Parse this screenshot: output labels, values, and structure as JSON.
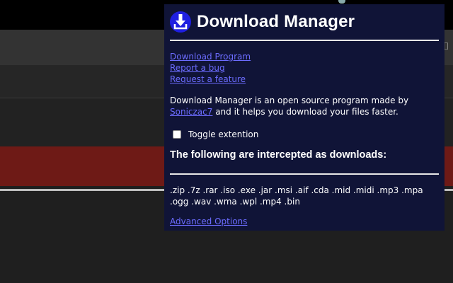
{
  "popup": {
    "title": "Download Manager",
    "links": [
      {
        "label": "Download Program"
      },
      {
        "label": "Report a bug"
      },
      {
        "label": "Request a feature"
      }
    ],
    "description_prefix": "Download Manager is an open source program made by ",
    "author": "Soniczac7",
    "description_suffix": " and it helps you download your files faster.",
    "toggle_label": "Toggle extention",
    "toggle_checked": false,
    "intercepted_heading": "The following are intercepted as downloads:",
    "extensions": ".zip .7z .rar .iso .exe .jar .msi .aif .cda .mid .midi .mp3 .mpa .ogg .wav .wma .wpl .mp4 .bin",
    "advanced_options_label": "Advanced Options"
  },
  "colors": {
    "popup_bg": "#101437",
    "link": "#6c6cff",
    "logo_circle": "#1f1fe0",
    "background_red": "#6e1a16"
  },
  "icons": {
    "logo": "download-arrow-icon"
  }
}
